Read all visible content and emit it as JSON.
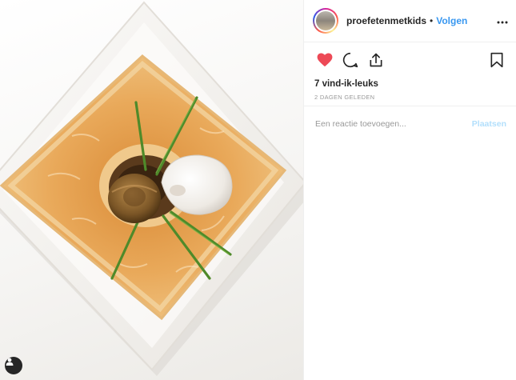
{
  "post": {
    "photo_alt": "Bladerdeeg tartelette met paddenstoelen en bieslook",
    "user_tag_icon": "user-silhouette-icon"
  },
  "header": {
    "username": "proefetenmetkids",
    "separator": "•",
    "follow_label": "Volgen",
    "more_icon": "more-options-icon"
  },
  "actions": {
    "like_icon": "heart-filled-icon",
    "like_color": "#ed4956",
    "comment_icon": "comment-icon",
    "share_icon": "share-icon",
    "save_icon": "bookmark-icon"
  },
  "likes": {
    "text": "7 vind-ik-leuks"
  },
  "timestamp": {
    "text": "2 DAGEN GELEDEN"
  },
  "comment": {
    "placeholder": "Een reactie toevoegen...",
    "post_label": "Plaatsen"
  },
  "colors": {
    "link": "#3897f0",
    "muted": "#999999",
    "disabled_link": "#b2dffc"
  }
}
